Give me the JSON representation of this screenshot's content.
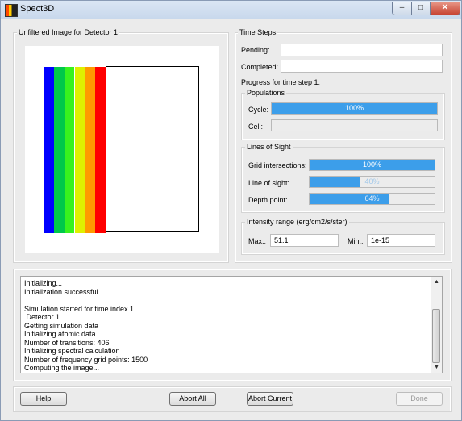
{
  "window": {
    "title": "Spect3D"
  },
  "image_panel": {
    "title": "Unfiltered Image for Detector 1",
    "stripes": [
      "#0000ff",
      "#00c84a",
      "#38f21e",
      "#dff000",
      "#ff9a00",
      "#ff0000"
    ]
  },
  "time_steps": {
    "title": "Time Steps",
    "pending_label": "Pending:",
    "pending_value": "",
    "completed_label": "Completed:",
    "completed_value": "",
    "progress_label": "Progress for time step 1:",
    "populations": {
      "title": "Populations",
      "cycle_label": "Cycle:",
      "cycle_text": "100%",
      "cycle_fraction": 1.0,
      "cell_label": "Cell:",
      "cell_fraction": 0
    },
    "lines_of_sight": {
      "title": "Lines of Sight",
      "grid_label": "Grid intersections:",
      "grid_text": "100%",
      "grid_fraction": 1.0,
      "los_label": "Line of sight:",
      "los_text": "40%",
      "los_fraction": 0.4,
      "depth_label": "Depth point:",
      "depth_text": "64%",
      "depth_fraction": 0.64
    },
    "intensity": {
      "title": "Intensity range (erg/cm2/s/ster)",
      "max_label": "Max.:",
      "max_value": "51.1",
      "min_label": "Min.:",
      "min_value": "1e-15"
    }
  },
  "log": {
    "lines": [
      "Initializing...",
      "Initialization successful.",
      "",
      "Simulation started for time index 1",
      " Detector 1",
      "Getting simulation data",
      "Initializing atomic data",
      "Number of transitions: 406",
      "Initializing spectral calculation",
      "Number of frequency grid points: 1500",
      "Computing the image..."
    ]
  },
  "buttons": {
    "help": "Help",
    "abort_all": "Abort All",
    "abort_current": "Abort Current",
    "done": "Done"
  },
  "icons": {
    "minimize": "minimize-icon",
    "maximize": "maximize-icon",
    "close": "close-icon",
    "scroll_up": "chevron-up-icon",
    "scroll_down": "chevron-down-icon"
  }
}
